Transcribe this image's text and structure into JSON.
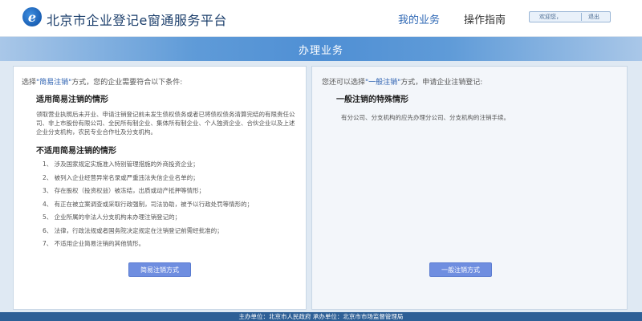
{
  "header": {
    "logo_glyph": "e",
    "title": "北京市企业登记e窗通服务平台",
    "nav": {
      "my_business": "我的业务",
      "guide": "操作指南"
    },
    "user": {
      "welcome": "欢迎您，",
      "logout": "退出"
    }
  },
  "banner": {
    "title": "办理业务"
  },
  "left_panel": {
    "intro_prefix": "选择",
    "intro_highlight": "\"简易注销\"",
    "intro_suffix": "方式，您的企业需要符合以下条件:",
    "applicable_title": "适用简易注销的情形",
    "applicable_text": "领取营业执照后未开业、申请注销登记前未发生债权债务或者已将债权债务清算完结的有限责任公司、非上市股份有限公司、全民所有制企业、集体所有制企业、个人独资企业、合伙企业以及上述企业分支机构，农民专业合作社及分支机构。",
    "not_applicable_title": "不适用简易注销的情形",
    "not_applicable_items": [
      "1、 涉及国家规定实施准入特别管理措施的外商投资企业；",
      "2、 被列入企业经营异常名录或严重违法失信企业名单的；",
      "3、 存在股权（投资权益）被冻结，出质或动产抵押等情形；",
      "4、 有正在被立案调查或采取行政强制，司法协助，被予以行政处罚等情形的；",
      "5、 企业所属的非法人分支机构未办理注销登记的；",
      "6、 法律，行政法规或者国务院决定规定在注销登记前需经批准的；",
      "7、 不适用企业简易注销的其他情形。"
    ],
    "button_label": "简易注销方式"
  },
  "right_panel": {
    "intro_prefix": "您还可以选择",
    "intro_highlight": "\"一般注销\"",
    "intro_suffix": "方式，申请企业注销登记:",
    "special_title": "一般注销的特殊情形",
    "special_text": "有分公司、分支机构的应先办理分公司、分支机构的注销手续。",
    "button_label": "一般注销方式"
  },
  "footer": {
    "text": "主办单位：北京市人民政府   承办单位：北京市市场监督管理局"
  },
  "colors": {
    "accent": "#2f68b5",
    "button": "#6f8ee0",
    "footer": "#2d5f96"
  }
}
